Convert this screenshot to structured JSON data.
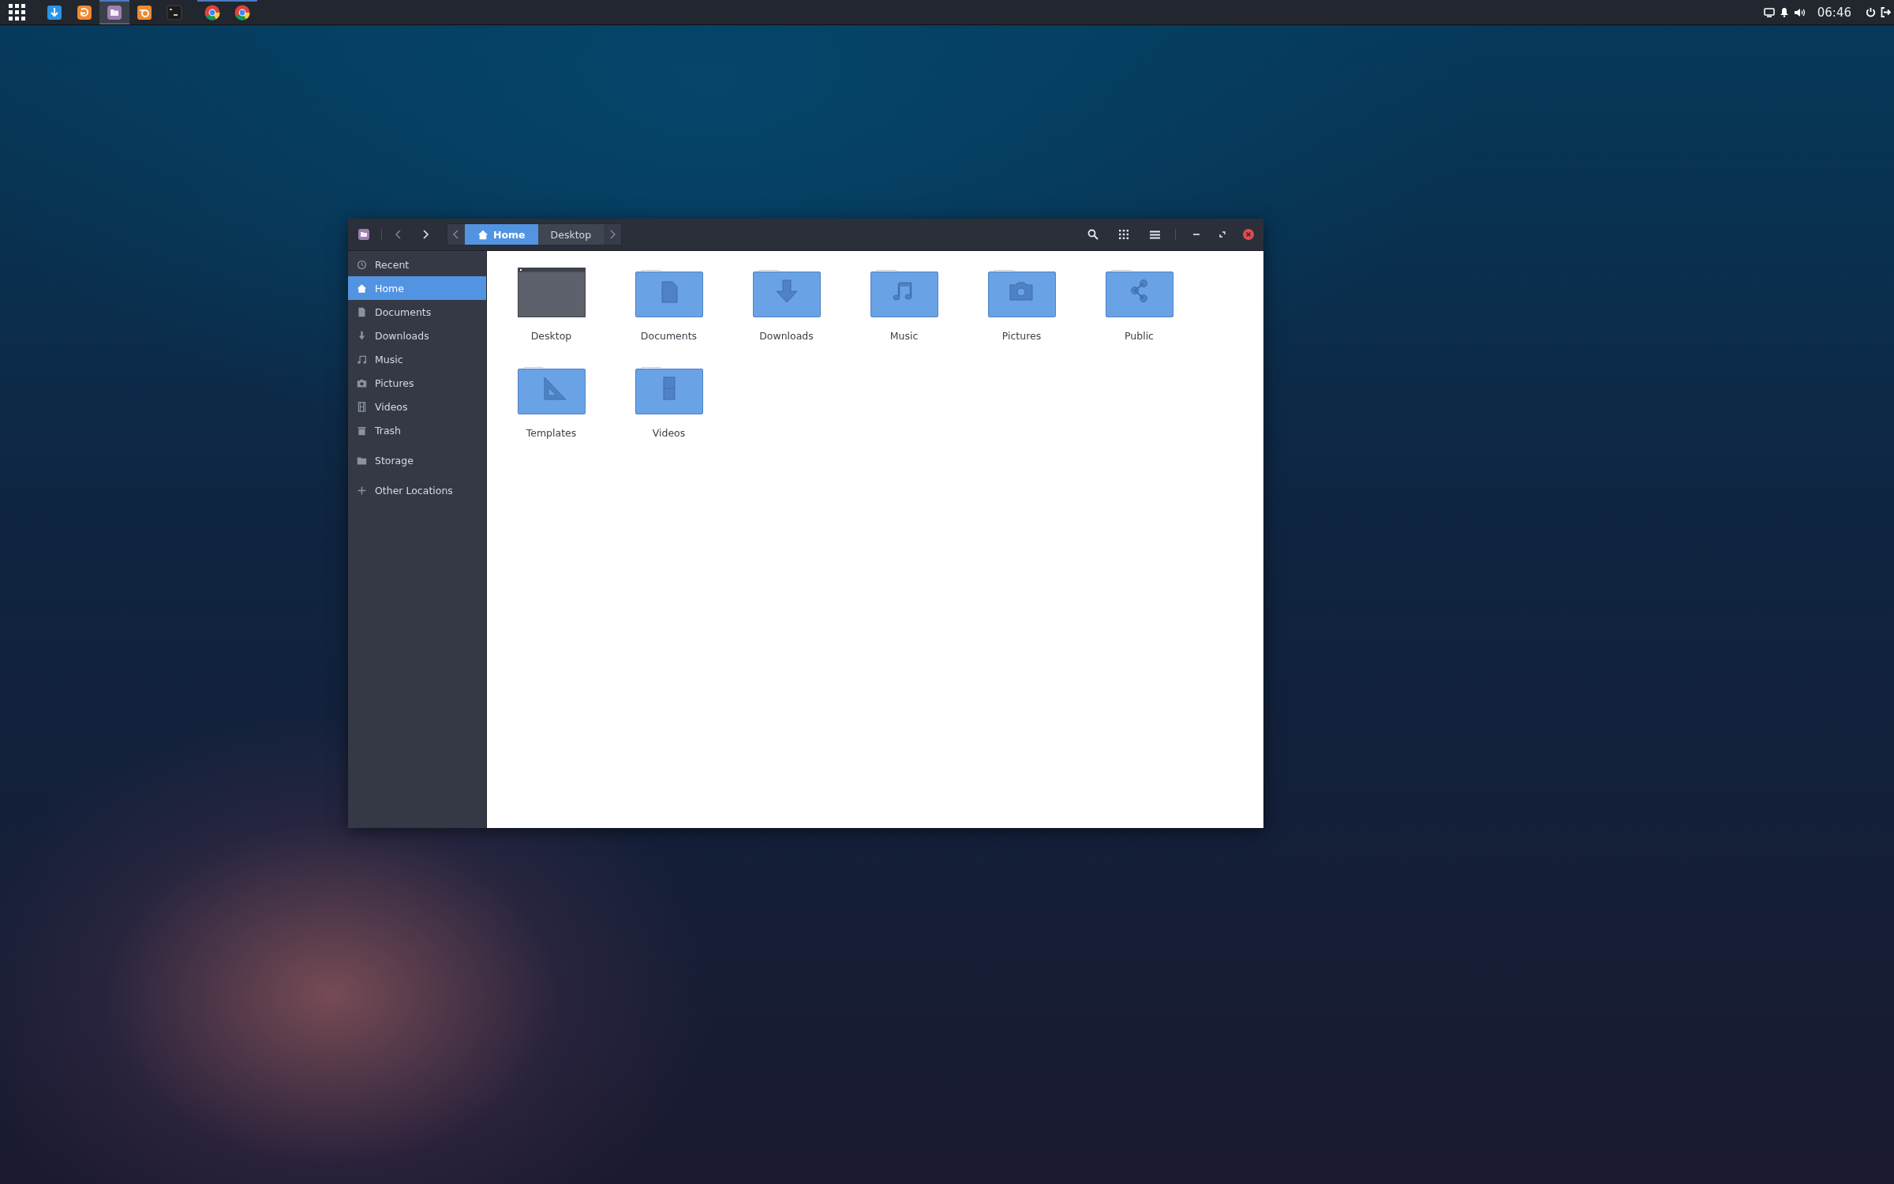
{
  "taskbar": {
    "apps": [
      {
        "kind": "downloads",
        "running": false,
        "selected": false
      },
      {
        "kind": "browser-fox",
        "running": false,
        "selected": false
      },
      {
        "kind": "files",
        "running": true,
        "selected": true
      },
      {
        "kind": "modeler",
        "running": false,
        "selected": false
      },
      {
        "kind": "terminal",
        "running": false,
        "selected": false
      },
      {
        "kind": "browser-ring",
        "running": true,
        "selected": false
      },
      {
        "kind": "browser-ring",
        "running": true,
        "selected": false
      }
    ],
    "clock": "06:46"
  },
  "window": {
    "breadcrumb": [
      {
        "label": "Home",
        "kind": "home",
        "selected": true
      },
      {
        "label": "Desktop",
        "kind": "plain",
        "selected": false
      }
    ],
    "sidebar": {
      "places": [
        {
          "label": "Recent",
          "kind": "recent",
          "selected": false
        },
        {
          "label": "Home",
          "kind": "home",
          "selected": true
        },
        {
          "label": "Documents",
          "kind": "document",
          "selected": false
        },
        {
          "label": "Downloads",
          "kind": "download",
          "selected": false
        },
        {
          "label": "Music",
          "kind": "music",
          "selected": false
        },
        {
          "label": "Pictures",
          "kind": "camera",
          "selected": false
        },
        {
          "label": "Videos",
          "kind": "film",
          "selected": false
        },
        {
          "label": "Trash",
          "kind": "trash",
          "selected": false
        }
      ],
      "devices": [
        {
          "label": "Storage",
          "kind": "drive",
          "selected": false
        }
      ],
      "other": [
        {
          "label": "Other Locations",
          "kind": "plus",
          "selected": false
        }
      ]
    },
    "folders": [
      {
        "name": "Desktop",
        "kind": "desktop"
      },
      {
        "name": "Documents",
        "kind": "document"
      },
      {
        "name": "Downloads",
        "kind": "download"
      },
      {
        "name": "Music",
        "kind": "music"
      },
      {
        "name": "Pictures",
        "kind": "camera"
      },
      {
        "name": "Public",
        "kind": "share"
      },
      {
        "name": "Templates",
        "kind": "triangle"
      },
      {
        "name": "Videos",
        "kind": "film"
      }
    ]
  }
}
